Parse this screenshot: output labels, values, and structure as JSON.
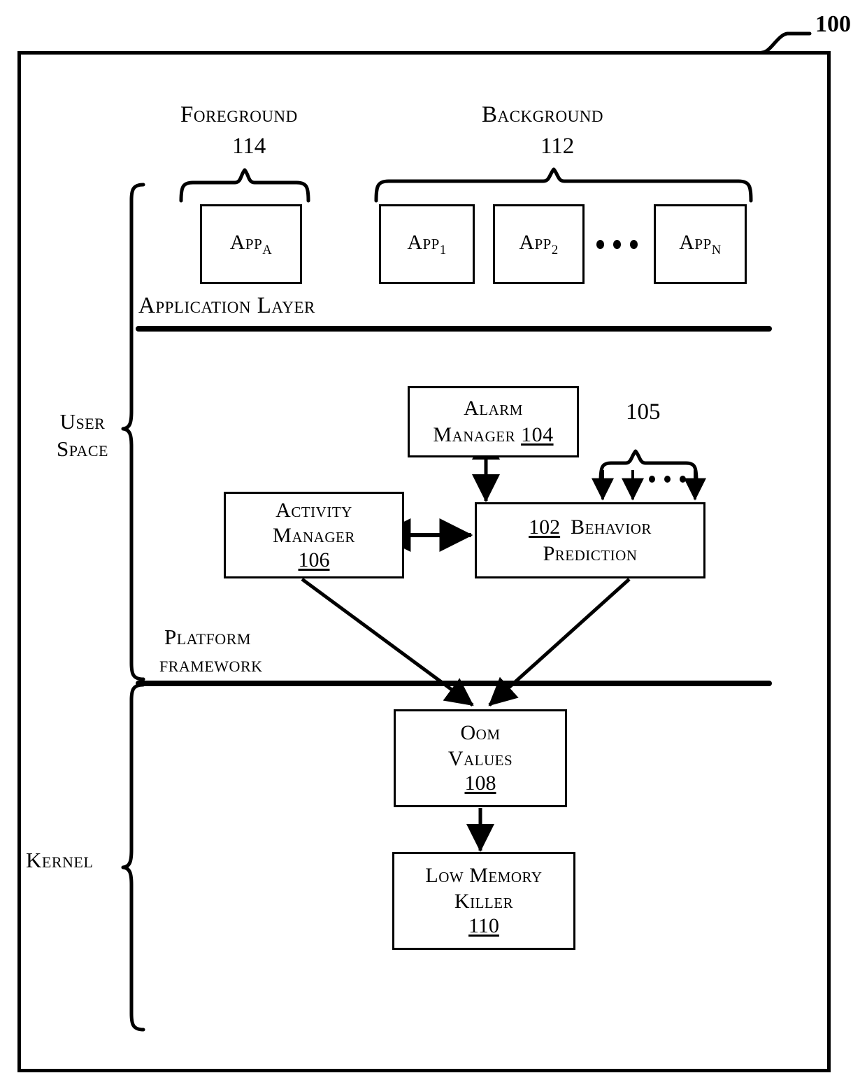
{
  "figure": {
    "number": "100"
  },
  "regions": {
    "user_space": "User\nSpace",
    "user_space_line1": "User",
    "user_space_line2": "Space",
    "kernel": "Kernel"
  },
  "application_layer": {
    "foreground_label": "Foreground",
    "foreground_ref": "114",
    "background_label": "Background",
    "background_ref": "112",
    "layer_label": "Application Layer",
    "foreground_apps": [
      {
        "name": "App",
        "subscript": "A"
      }
    ],
    "background_apps": [
      {
        "name": "App",
        "subscript": "1"
      },
      {
        "name": "App",
        "subscript": "2"
      },
      {
        "name": "App",
        "subscript": "N"
      }
    ],
    "ellipsis": "•••"
  },
  "platform_framework": {
    "label_line1": "Platform",
    "label_line2": "framework",
    "blocks": [
      {
        "id": "alarm-manager",
        "line1": "Alarm",
        "line2": "Manager",
        "ref": "104"
      },
      {
        "id": "activity-manager",
        "line1": "Activity",
        "line2": "Manager",
        "ref": "106"
      },
      {
        "id": "behavior-prediction",
        "ref": "102",
        "line1": "Behavior",
        "line2": "Prediction"
      }
    ],
    "input_group_ref": "105"
  },
  "kernel_space": {
    "blocks": [
      {
        "id": "oom-values",
        "line1": "Oom",
        "line2": "Values",
        "ref": "108"
      },
      {
        "id": "low-memory-killer",
        "line1": "Low Memory",
        "line2": "Killer",
        "ref": "110"
      }
    ]
  },
  "colors": {
    "stroke": "#000000",
    "background": "#ffffff"
  }
}
